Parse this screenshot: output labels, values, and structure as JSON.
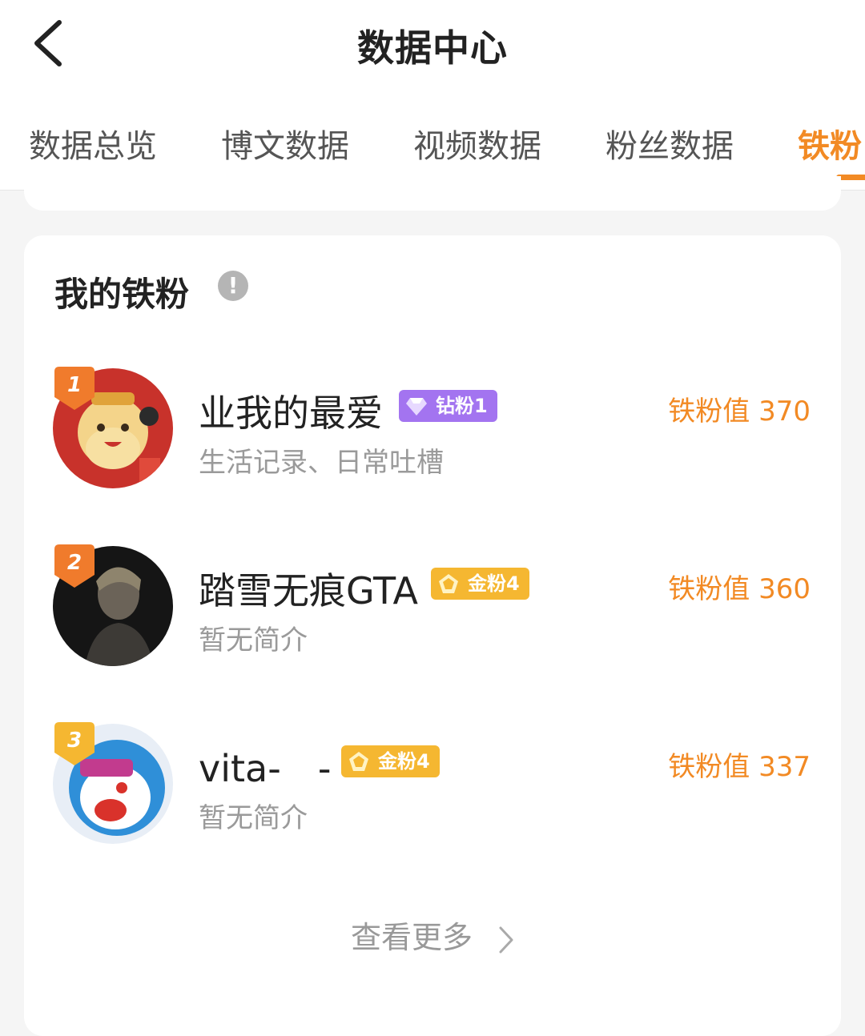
{
  "header": {
    "title": "数据中心",
    "back_icon": "chevron-left-icon"
  },
  "tabs": [
    {
      "label": "数据总览",
      "active": false
    },
    {
      "label": "博文数据",
      "active": false
    },
    {
      "label": "视频数据",
      "active": false
    },
    {
      "label": "粉丝数据",
      "active": false
    },
    {
      "label": "铁粉",
      "active": true
    }
  ],
  "accent_color": "#f28a24",
  "section": {
    "title": "我的铁粉",
    "info_icon": "info-icon",
    "info_glyph": "!",
    "more_label": "查看更多"
  },
  "fans": [
    {
      "rank": "1",
      "name": "业我的最爱",
      "badge": "钻粉1",
      "badge_icon": "diamond-icon",
      "badge_color": "#a374f0",
      "bio": "生活记录、日常吐槽",
      "value": "铁粉值 370",
      "rank_color": "#f07b2c"
    },
    {
      "rank": "2",
      "name": "踏雪无痕GTA",
      "badge": "金粉4",
      "badge_icon": "gold-gem-icon",
      "badge_color": "#f5b731",
      "bio": "暂无简介",
      "value": "铁粉值 360",
      "rank_color": "#f07b2c"
    },
    {
      "rank": "3",
      "name": "vita-　-",
      "badge": "金粉4",
      "badge_icon": "gold-gem-icon",
      "badge_color": "#f5b731",
      "bio": "暂无简介",
      "value": "铁粉值 337",
      "rank_color": "#f5b731"
    }
  ]
}
